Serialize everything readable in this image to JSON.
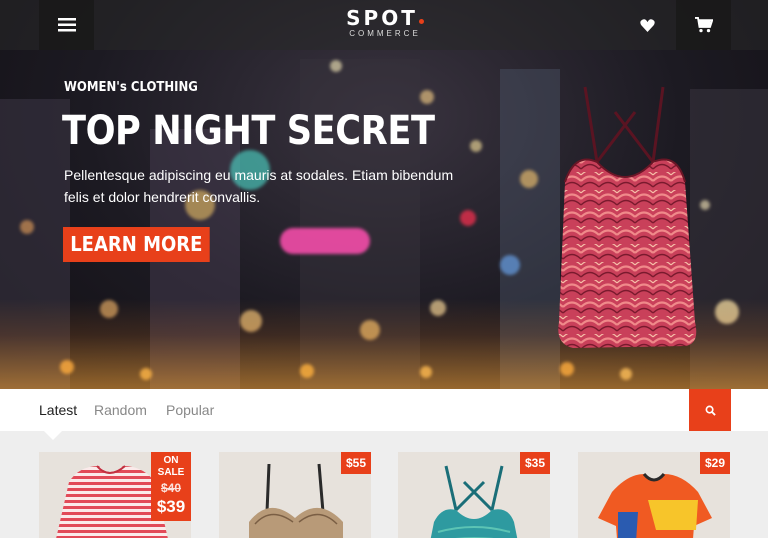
{
  "header": {
    "logo_main": "SPOT",
    "logo_sub": "COMMERCE",
    "menu_icon": "hamburger-icon",
    "wishlist_icon": "heart-icon",
    "cart_icon": "cart-icon"
  },
  "hero": {
    "eyebrow": "WOMEN's CLOTHING",
    "title": "TOP NIGHT SECRET",
    "description": "Pellentesque adipiscing eu mauris at sodales. Etiam bibendum felis et dolor hendrerit convallis.",
    "button_label": "LEARN MORE"
  },
  "tabs": [
    {
      "label": "Latest",
      "active": true
    },
    {
      "label": "Random",
      "active": false
    },
    {
      "label": "Popular",
      "active": false
    }
  ],
  "search_icon": "search-icon",
  "products": [
    {
      "name": "striped-top",
      "sale_label": "ON SALE",
      "old_price": "$40",
      "price": "$39"
    },
    {
      "name": "lace-bra",
      "price": "$55"
    },
    {
      "name": "green-tank",
      "price": "$35"
    },
    {
      "name": "sport-tee",
      "price": "$29"
    }
  ],
  "colors": {
    "accent": "#e8401a",
    "dark": "#222222"
  }
}
